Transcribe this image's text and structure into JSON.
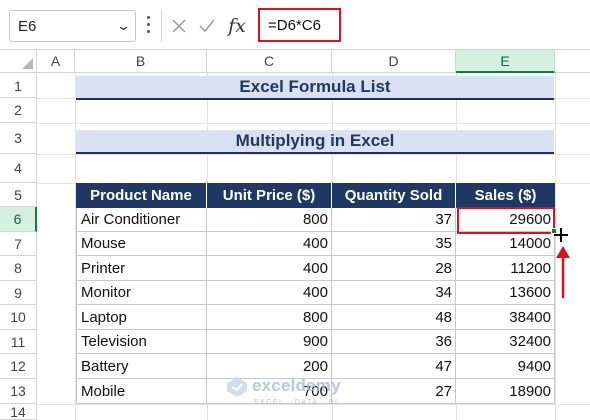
{
  "formula_bar": {
    "name_box": "E6",
    "fx_label": "fx",
    "formula": "=D6*C6"
  },
  "columns": [
    "A",
    "B",
    "C",
    "D",
    "E"
  ],
  "rows": [
    "1",
    "2",
    "3",
    "4",
    "5",
    "6",
    "7",
    "8",
    "9",
    "10",
    "11",
    "12",
    "13",
    "14"
  ],
  "selected": {
    "column": "E",
    "row": "6"
  },
  "sheet": {
    "title": "Excel Formula List",
    "subtitle": "Multiplying in Excel",
    "table": {
      "headers": [
        "Product Name",
        "Unit Price ($)",
        "Quantity Sold",
        "Sales ($)"
      ],
      "rows": [
        [
          "Air Conditioner",
          "800",
          "37",
          "29600"
        ],
        [
          "Mouse",
          "400",
          "35",
          "14000"
        ],
        [
          "Printer",
          "400",
          "28",
          "11200"
        ],
        [
          "Monitor",
          "400",
          "34",
          "13600"
        ],
        [
          "Laptop",
          "800",
          "48",
          "38400"
        ],
        [
          "Television",
          "900",
          "36",
          "32400"
        ],
        [
          "Battery",
          "200",
          "47",
          "9400"
        ],
        [
          "Mobile",
          "700",
          "27",
          "18900"
        ]
      ]
    }
  },
  "watermark": {
    "name": "exceldemy",
    "tagline": "EXCEL · DATA · BI"
  },
  "colors": {
    "header_fill": "#1f3864",
    "band_fill": "#d9e1f2",
    "highlight": "#e0101a",
    "excel_green": "#107c41"
  }
}
